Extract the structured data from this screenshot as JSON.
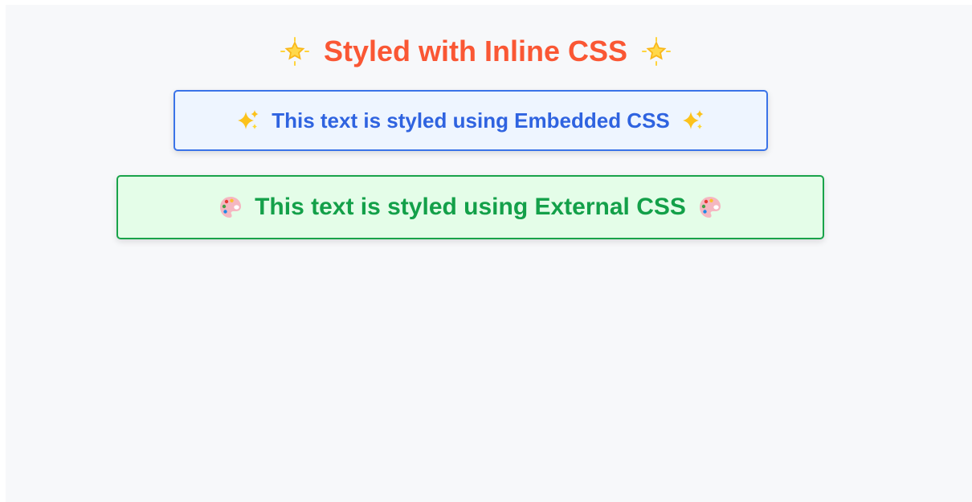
{
  "colors": {
    "heading": "#fa5734",
    "embedded_text": "#2f63e0",
    "embedded_border": "#3a73e8",
    "embedded_bg": "#eef5ff",
    "external_text": "#13a049",
    "external_border": "#19a34a",
    "external_bg": "#e4fde8",
    "page_bg": "#f7f8fa"
  },
  "heading": {
    "text": "Styled with Inline CSS",
    "icon": "glowing-star-icon"
  },
  "embedded": {
    "text": "This text is styled using Embedded CSS",
    "icon": "sparkles-icon"
  },
  "external": {
    "text": "This text is styled using External CSS",
    "icon": "artist-palette-icon"
  }
}
